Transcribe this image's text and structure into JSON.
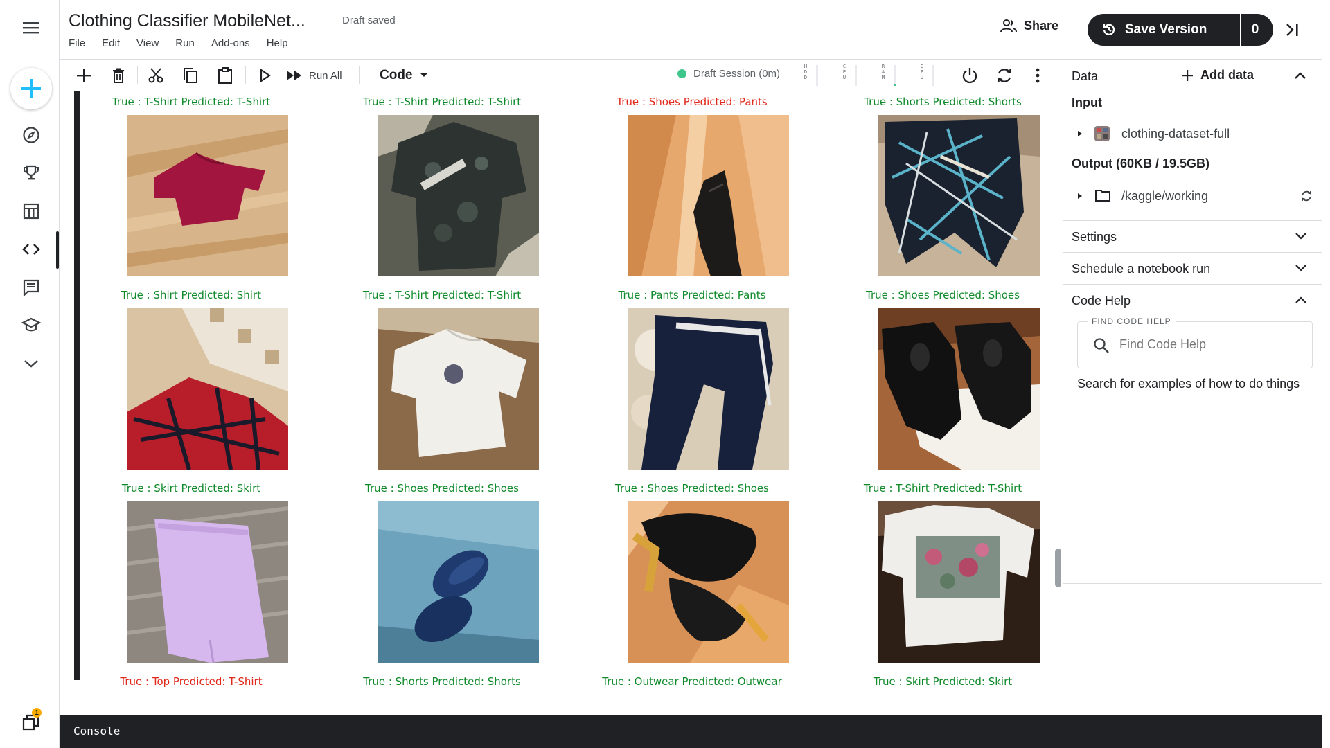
{
  "app": {
    "title": "Clothing Classifier MobileNet...",
    "status": "Draft saved",
    "menu": [
      "File",
      "Edit",
      "View",
      "Run",
      "Add-ons",
      "Help"
    ],
    "share_label": "Share",
    "save_version_label": "Save Version",
    "save_version_count": "0"
  },
  "toolbar": {
    "run_all_label": "Run All",
    "cell_type": "Code",
    "session_label": "Draft Session (0m)",
    "meters": [
      {
        "label": "HDD",
        "fill": 0.0
      },
      {
        "label": "CPU",
        "fill": 0.0
      },
      {
        "label": "RAM",
        "fill": 0.08
      },
      {
        "label": "GPU",
        "fill": 0.0
      }
    ]
  },
  "results": [
    {
      "caption": "True : T-Shirt Predicted: T-Shirt",
      "correct": true,
      "scene": "red-shirt"
    },
    {
      "caption": "True : T-Shirt Predicted: T-Shirt",
      "correct": true,
      "scene": "camo-shirt"
    },
    {
      "caption": "True : Shoes Predicted: Pants",
      "correct": false,
      "scene": "black-boot"
    },
    {
      "caption": "True : Shorts Predicted: Shorts",
      "correct": true,
      "scene": "pattern-shorts"
    },
    {
      "caption": "True : Shirt Predicted: Shirt",
      "correct": true,
      "scene": "plaid-shirt"
    },
    {
      "caption": "True : T-Shirt Predicted: T-Shirt",
      "correct": true,
      "scene": "white-tshirt"
    },
    {
      "caption": "True : Pants Predicted: Pants",
      "correct": true,
      "scene": "navy-pants"
    },
    {
      "caption": "True : Shoes Predicted: Shoes",
      "correct": true,
      "scene": "black-sneakers"
    },
    {
      "caption": "True : Skirt Predicted: Skirt",
      "correct": true,
      "scene": "lilac-skirt"
    },
    {
      "caption": "True : Shoes Predicted: Shoes",
      "correct": true,
      "scene": "blue-slippers"
    },
    {
      "caption": "True : Shoes Predicted: Shoes",
      "correct": true,
      "scene": "heels"
    },
    {
      "caption": "True : T-Shirt Predicted: T-Shirt",
      "correct": true,
      "scene": "print-tshirt"
    },
    {
      "caption": "True : Top Predicted: T-Shirt",
      "correct": false,
      "scene": "cut"
    },
    {
      "caption": "True : Shorts Predicted: Shorts",
      "correct": true,
      "scene": "cut"
    },
    {
      "caption": "True : Outwear Predicted: Outwear",
      "correct": true,
      "scene": "cut"
    },
    {
      "caption": "True : Skirt Predicted: Skirt",
      "correct": true,
      "scene": "cut"
    }
  ],
  "panel": {
    "data_header": "Data",
    "add_data_label": "Add data",
    "input_header": "Input",
    "input_dataset": "clothing-dataset-full",
    "output_header": "Output (60KB / 19.5GB)",
    "output_path": "/kaggle/working",
    "settings_label": "Settings",
    "schedule_label": "Schedule a notebook run",
    "code_help_label": "Code Help",
    "find_legend": "FIND CODE HELP",
    "find_placeholder": "Find Code Help",
    "find_hint": "Search for examples of how to do things"
  },
  "console": {
    "label": "Console"
  },
  "notifications": {
    "count": "1"
  },
  "colors": {
    "correct": "#0f8a2a",
    "incorrect": "#e0281b",
    "accent_blue": "#20beff",
    "session_green": "#3fc68a"
  }
}
